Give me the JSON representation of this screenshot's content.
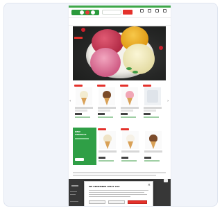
{
  "header": {
    "search_placeholder": "",
    "search_button": "",
    "icons": [
      "location-icon",
      "user-icon",
      "heart-icon",
      "cart-icon"
    ],
    "icon_labels": [
      "",
      "",
      "",
      ""
    ]
  },
  "nav": {
    "items": [
      "",
      "",
      "",
      "",
      ""
    ]
  },
  "hero": {
    "image": "ice-cream-bowl"
  },
  "products": {
    "items": [
      {
        "name": "",
        "badge": "",
        "type": "vanilla-cone"
      },
      {
        "name": "",
        "badge": "",
        "type": "chocolate-cone"
      },
      {
        "name": "",
        "badge": "",
        "type": "strawberry-cone"
      },
      {
        "name": "",
        "badge": "",
        "type": "ice-cream-box"
      }
    ]
  },
  "promo": {
    "heading": "NEW\nARRIVALS",
    "items": [
      {
        "type": "vanilla-cone"
      },
      {
        "type": "white-cone"
      },
      {
        "type": "chocolate-cone"
      }
    ]
  },
  "modal": {
    "title": "WE REMEMBER WHAT YOU",
    "close": "×",
    "primary_button": "",
    "secondary_button": ""
  },
  "colors": {
    "brand_green": "#2f9f46",
    "accent_red": "#e4312b",
    "footer": "#373737"
  }
}
